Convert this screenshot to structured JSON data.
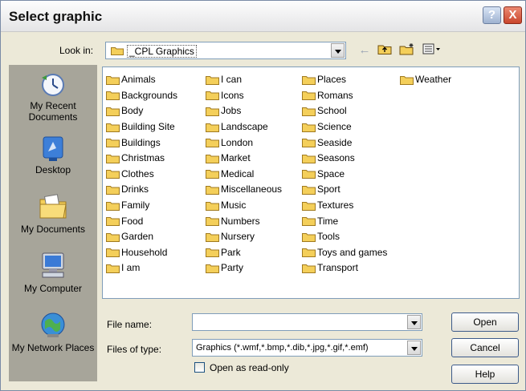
{
  "window": {
    "title": "Select graphic",
    "help_glyph": "?",
    "close_glyph": "X"
  },
  "lookin": {
    "label": "Look in:",
    "value": "_CPL Graphics"
  },
  "toolbar": {
    "back_glyph": "←",
    "up_glyph": "↑",
    "newfolder_glyph": "✱",
    "views_glyph": "▦"
  },
  "places": [
    {
      "label": "My Recent Documents",
      "icon": "recent-documents-icon"
    },
    {
      "label": "Desktop",
      "icon": "desktop-icon"
    },
    {
      "label": "My Documents",
      "icon": "my-documents-icon"
    },
    {
      "label": "My Computer",
      "icon": "my-computer-icon"
    },
    {
      "label": "My Network Places",
      "icon": "network-places-icon"
    }
  ],
  "folders": {
    "col1": [
      "Animals",
      "Backgrounds",
      "Body",
      "Building Site",
      "Buildings",
      "Christmas",
      "Clothes",
      "Drinks",
      "Family",
      "Food",
      "Garden",
      "Household",
      "I am"
    ],
    "col2": [
      "I can",
      "Icons",
      "Jobs",
      "Landscape",
      "London",
      "Market",
      "Medical",
      "Miscellaneous",
      "Music",
      "Numbers",
      "Nursery",
      "Park",
      "Party"
    ],
    "col3": [
      "Places",
      "Romans",
      "School",
      "Science",
      "Seaside",
      "Seasons",
      "Space",
      "Sport",
      "Textures",
      "Time",
      "Tools",
      "Toys and games",
      "Transport"
    ],
    "col4": [
      "Weather"
    ]
  },
  "filename": {
    "label": "File name:",
    "value": ""
  },
  "filetype": {
    "label": "Files of type:",
    "value": "Graphics (*.wmf,*.bmp,*.dib,*.jpg,*.gif,*.emf)"
  },
  "readonly": {
    "label": "Open as read-only",
    "checked": false
  },
  "buttons": {
    "open": "Open",
    "cancel": "Cancel",
    "help": "Help"
  },
  "colors": {
    "folder": "#f4cf5a",
    "dialog_bg": "#ece9d8",
    "places_bg": "#a7a59a"
  }
}
